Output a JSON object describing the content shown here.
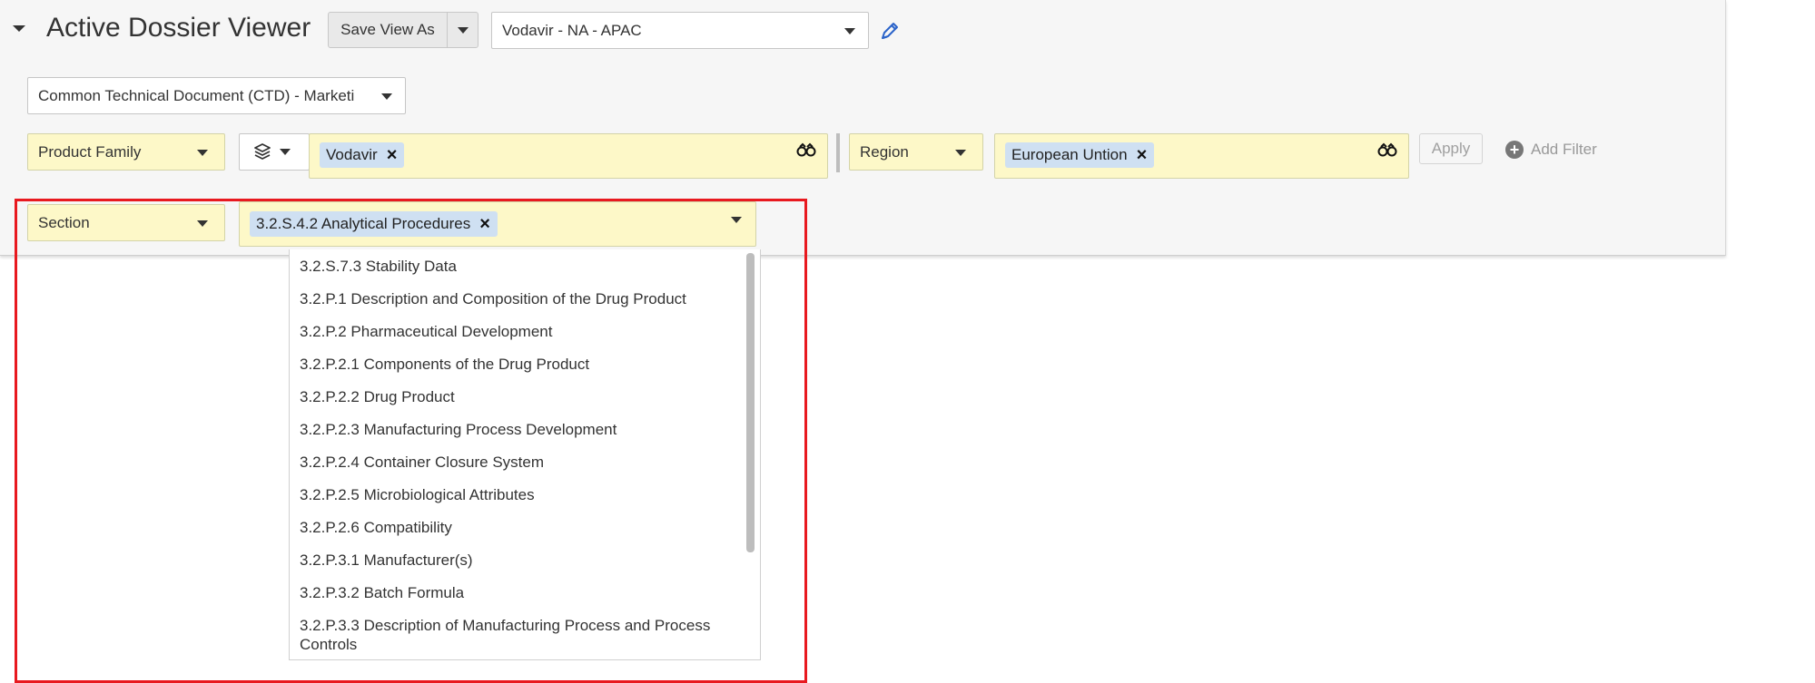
{
  "header": {
    "title": "Active Dossier Viewer",
    "save_view_label": "Save View As",
    "view_select_value": "Vodavir - NA - APAC"
  },
  "document_type": {
    "value": "Common Technical Document (CTD) - Marketi"
  },
  "filters": {
    "product_family": {
      "label": "Product Family",
      "chips": [
        "Vodavir"
      ]
    },
    "region": {
      "label": "Region",
      "chips": [
        "European Untion"
      ]
    },
    "apply_label": "Apply",
    "add_filter_label": "Add Filter"
  },
  "section_filter": {
    "label": "Section",
    "chips": [
      "3.2.S.4.2 Analytical Procedures"
    ]
  },
  "section_options": [
    "3.2.S.7.3 Stability Data",
    "3.2.P.1 Description and Composition of the Drug Product",
    "3.2.P.2 Pharmaceutical Development",
    "3.2.P.2.1 Components of the Drug Product",
    "3.2.P.2.2 Drug Product",
    "3.2.P.2.3 Manufacturing Process Development",
    "3.2.P.2.4 Container Closure System",
    "3.2.P.2.5 Microbiological Attributes",
    "3.2.P.2.6 Compatibility",
    "3.2.P.3.1 Manufacturer(s)",
    "3.2.P.3.2 Batch Formula",
    "3.2.P.3.3 Description of Manufacturing Process and Process Controls"
  ],
  "icons": {
    "pencil": "edit-pencil-icon",
    "binoculars": "binoculars-icon",
    "layers": "layers-icon",
    "plus": "add-circle-icon"
  },
  "colors": {
    "highlight": "#e8191f",
    "filter_bg": "#fdf8c8",
    "chip_bg": "#cfe0f2",
    "accent": "#2a63c9"
  }
}
